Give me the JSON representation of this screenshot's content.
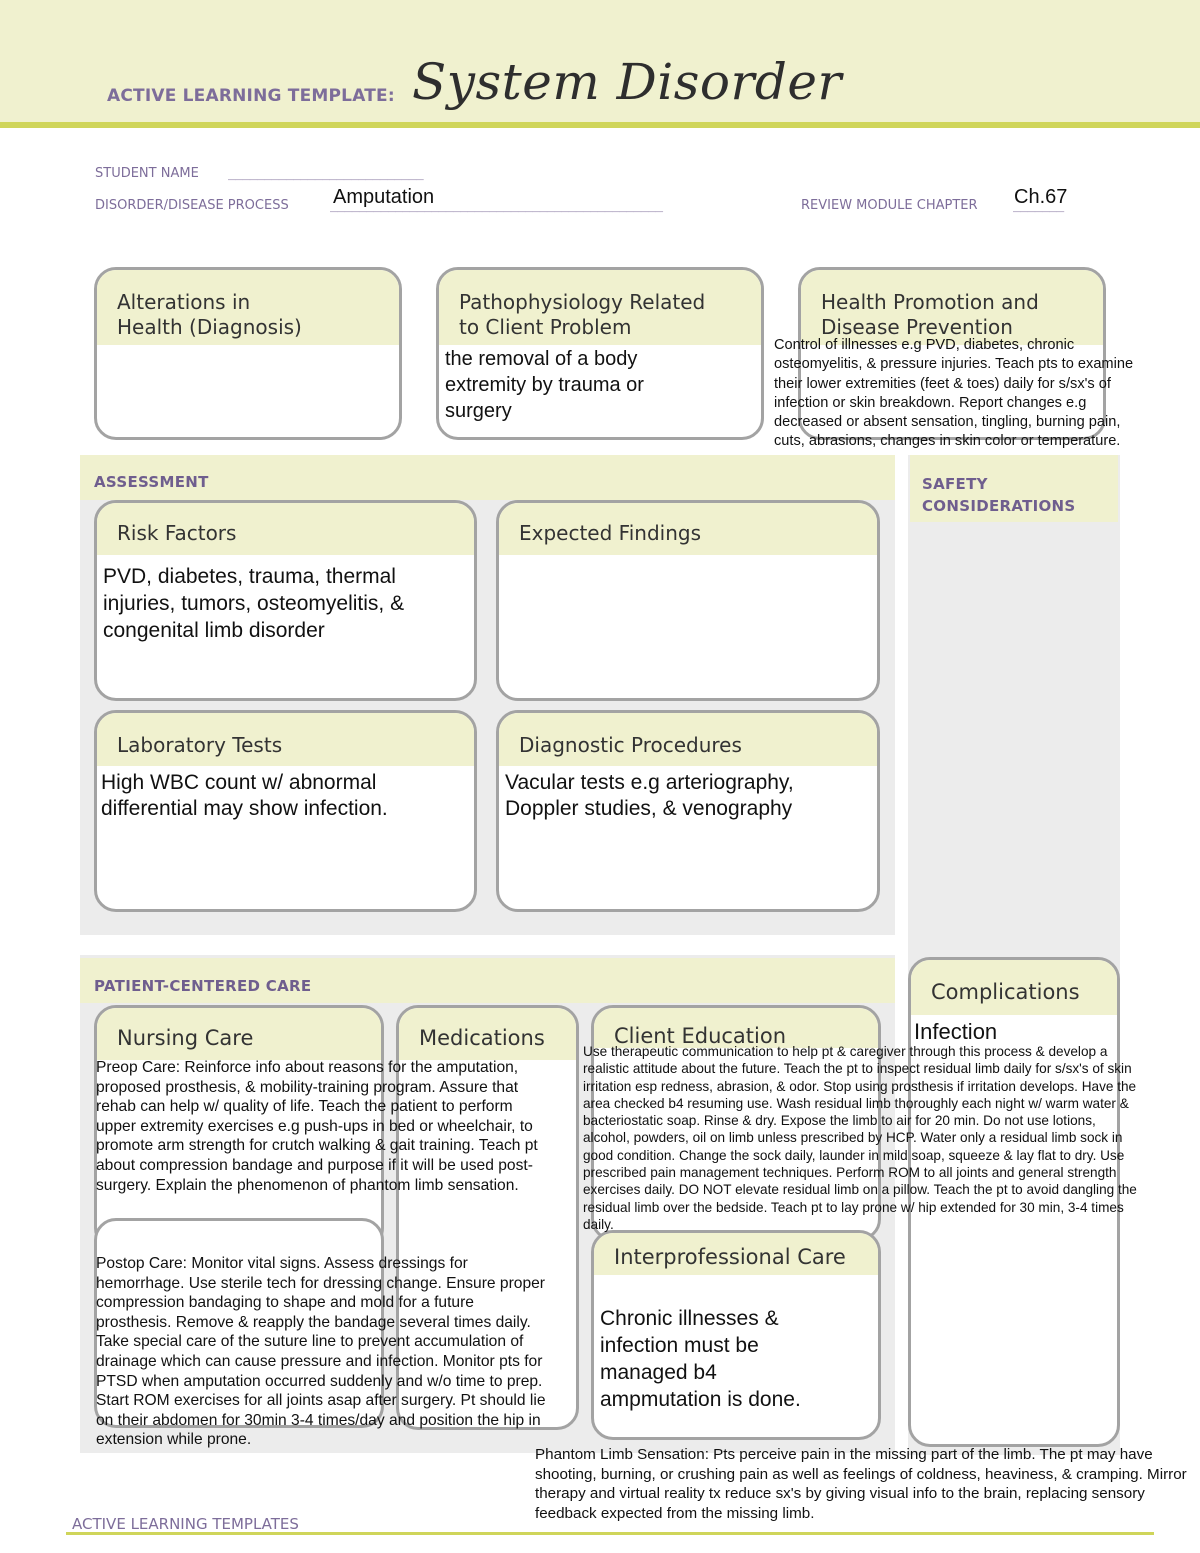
{
  "header": {
    "kicker": "ACTIVE LEARNING TEMPLATE:",
    "title": "System Disorder"
  },
  "fields": {
    "student_name_label": "STUDENT NAME",
    "student_name_value": "",
    "student_name_line": "___________________________",
    "disorder_label": "DISORDER/DISEASE PROCESS",
    "disorder_value": "Amputation",
    "disorder_line": "______________________________________________",
    "chapter_label": "REVIEW MODULE CHAPTER",
    "chapter_value": "Ch.67",
    "chapter_line": "_______"
  },
  "top_cards": {
    "alterations": {
      "title_line1": "Alterations in",
      "title_line2": "Health (Diagnosis)",
      "body": ""
    },
    "pathophysiology": {
      "title_line1": "Pathophysiology Related",
      "title_line2": "to Client Problem",
      "body": "the removal of a body extremity by trauma or surgery"
    },
    "health_promotion": {
      "title_line1": "Health Promotion and",
      "title_line2": "Disease Prevention",
      "body": "Control of illnesses e.g PVD, diabetes, chronic osteomyelitis, & pressure injuries. Teach pts to examine their lower extremities (feet & toes) daily for s/sx's of infection or skin breakdown. Report changes e.g decreased or absent sensation, tingling, burning pain, cuts, abrasions, changes in skin color or temperature."
    }
  },
  "assessment": {
    "section_title": "ASSESSMENT",
    "risk_factors": {
      "title": "Risk Factors",
      "body": "PVD, diabetes, trauma, thermal injuries, tumors, osteomyelitis, & congenital limb disorder"
    },
    "expected_findings": {
      "title": "Expected Findings",
      "body": ""
    },
    "laboratory_tests": {
      "title": "Laboratory Tests",
      "body": "High WBC count w/ abnormal differential may show infection."
    },
    "diagnostic_procedures": {
      "title": "Diagnostic Procedures",
      "body": "Vacular tests e.g arteriography, Doppler studies, & venography"
    }
  },
  "safety": {
    "section_title_line1": "SAFETY",
    "section_title_line2": "CONSIDERATIONS"
  },
  "patient_centered_care": {
    "section_title": "PATIENT-CENTERED CARE",
    "nursing_care": {
      "title": "Nursing Care",
      "preop": "Preop Care: Reinforce info about reasons for the amputation, proposed prosthesis, & mobility-training program. Assure that rehab can help w/ quality of life. Teach the patient to perform upper extremity exercises e.g push-ups in bed or wheelchair, to promote arm strength for crutch walking & gait training. Teach pt about compression bandage and purpose if it will be used post-surgery. Explain the phenomenon of phantom limb sensation.",
      "postop": "Postop Care: Monitor vital signs. Assess dressings for hemorrhage. Use sterile tech for dressing change. Ensure proper compression bandaging to shape and mold for a future prosthesis. Remove & reapply the bandage several times daily. Take special care of the suture line to prevent accumulation of drainage which can cause pressure and infection. Monitor pts for PTSD when amputation occurred suddenly and w/o time to prep. Start ROM exercises for all joints asap after surgery. Pt should lie on their abdomen for 30min 3-4 times/day and position the hip in extension while prone."
    },
    "medications": {
      "title": "Medications",
      "body": ""
    },
    "client_education": {
      "title": "Client Education",
      "body": "Use therapeutic communication to help pt & caregiver through this process & develop a realistic attitude about the future. Teach the pt to inspect residual limb daily for s/sx's of skin irritation esp redness, abrasion, & odor. Stop using prosthesis if irritation develops. Have the area checked b4 resuming use. Wash residual limb thoroughly each night w/ warm water & bacteriostatic soap. Rinse & dry. Expose the limb to air for 20 min. Do not use lotions, alcohol, powders, oil on limb unless prescribed by HCP. Water only a residual limb sock in good condition. Change the sock daily, launder in mild soap, squeeze & lay flat to dry. Use prescribed pain management techniques. Perform ROM to all joints and general strength exercises daily. DO NOT elevate residual limb on a pillow. Teach the pt to avoid dangling the residual limb over the bedside. Teach pt to lay prone w/ hip extended for 30 min, 3-4 times daily."
    },
    "interprofessional_care": {
      "title": "Interprofessional Care",
      "body": "Chronic illnesses & infection must be managed b4 ampmutation is done."
    },
    "complications": {
      "title": "Complications",
      "body": "Infection"
    },
    "phantom_limb": "Phantom Limb Sensation: Pts perceive pain in the missing part of the limb. The pt may have shooting, burning, or crushing pain as well as feelings of coldness, heaviness, & cramping. Mirror therapy and virtual reality tx reduce sx's by giving visual info to the brain, replacing sensory feedback expected from the missing limb."
  },
  "footer": {
    "label": "ACTIVE LEARNING TEMPLATES"
  }
}
